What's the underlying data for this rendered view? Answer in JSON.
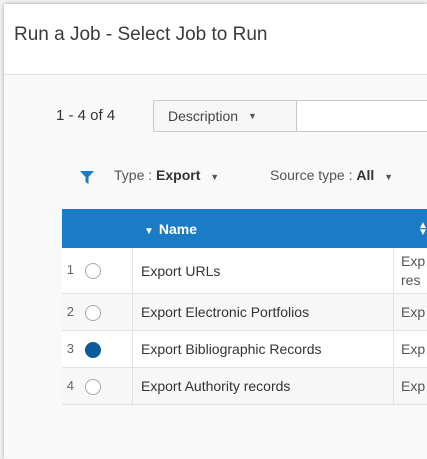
{
  "page": {
    "title": "Run a Job - Select Job to Run"
  },
  "toolbar": {
    "counter": "1 - 4 of 4",
    "search_field": "Description",
    "search_value": ""
  },
  "facets": [
    {
      "label": "Type",
      "value": "Export"
    },
    {
      "label": "Source type",
      "value": "All"
    }
  ],
  "table": {
    "columns": [
      "Name"
    ],
    "rows": [
      {
        "num": "1",
        "name": "Export URLs",
        "desc_line1": "Exp",
        "desc_line2": "res",
        "selected": false
      },
      {
        "num": "2",
        "name": "Export Electronic Portfolios",
        "desc_line1": "Exp",
        "desc_line2": "",
        "selected": false
      },
      {
        "num": "3",
        "name": "Export Bibliographic Records",
        "desc_line1": "Exp",
        "desc_line2": "",
        "selected": true
      },
      {
        "num": "4",
        "name": "Export Authority records",
        "desc_line1": "Exp",
        "desc_line2": "",
        "selected": false
      }
    ]
  },
  "colors": {
    "header_blue": "#1a7bc7",
    "radio_selected": "#0b5a9c"
  }
}
